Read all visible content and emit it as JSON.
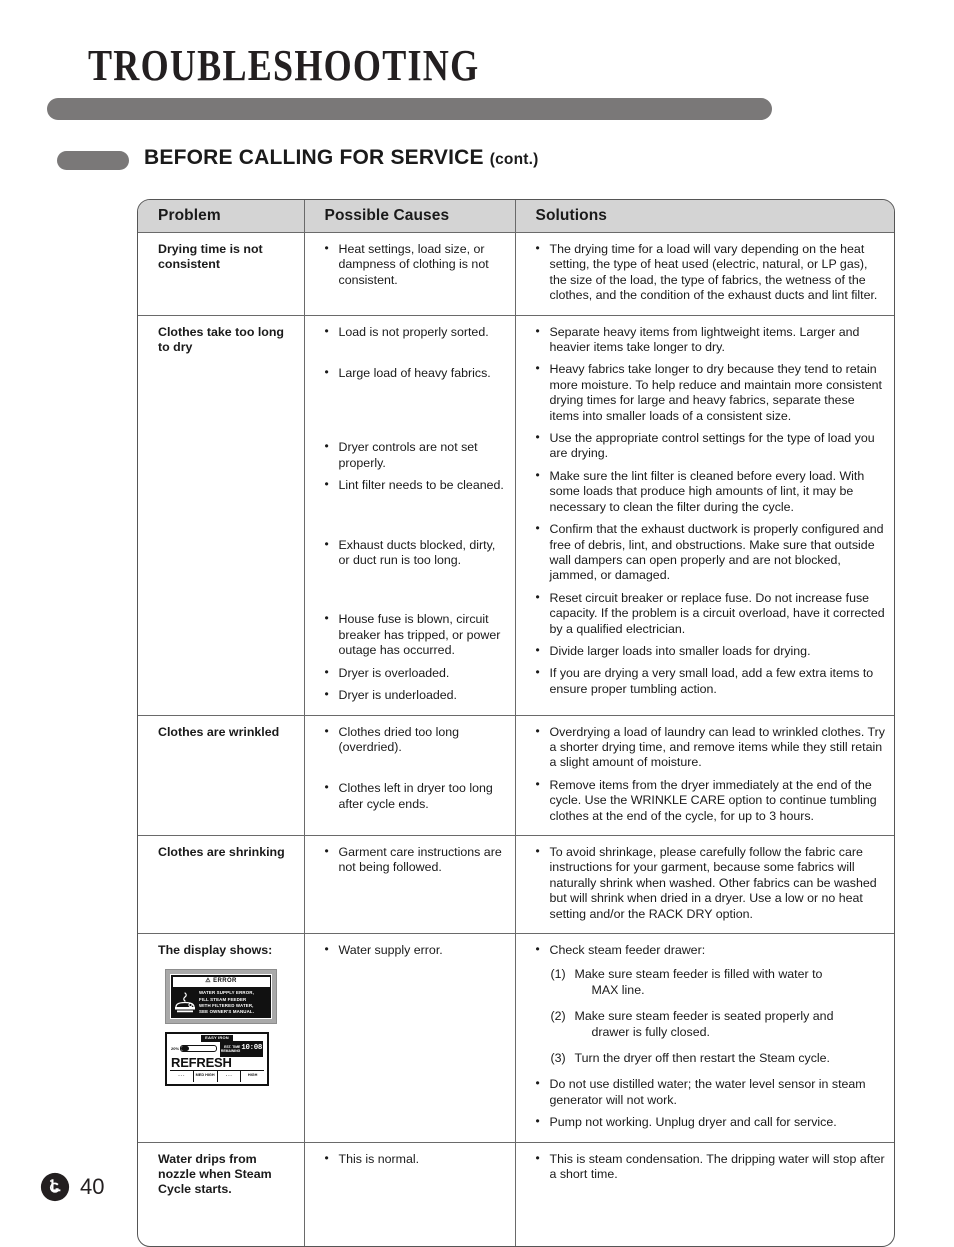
{
  "header": {
    "title": "TROUBLESHOOTING",
    "section_title": "BEFORE CALLING FOR SERVICE",
    "section_suffix": "(cont.)",
    "bar_color": "#7a7878"
  },
  "table": {
    "columns": [
      "Problem",
      "Possible Causes",
      "Solutions"
    ],
    "rows": [
      {
        "problem": "Drying time is not consistent",
        "causes": [
          "Heat settings, load size, or dampness of clothing is not consistent."
        ],
        "solutions": [
          "The drying time for a load will vary depending on the heat setting, the type of heat used (electric, natural, or LP gas), the size of the load, the type of fabrics, the wetness of the clothes, and the condition of the exhaust ducts and lint filter."
        ]
      },
      {
        "problem": "Clothes take too long to dry",
        "causes": [
          "Load is not properly sorted.",
          "Large load of heavy fabrics.",
          "Dryer controls are not set properly.",
          "Lint filter needs to be cleaned.",
          "Exhaust ducts blocked, dirty, or duct run is too long.",
          "House fuse is blown, circuit breaker has tripped, or power outage has occurred.",
          "Dryer is overloaded.",
          "Dryer is underloaded."
        ],
        "solutions": [
          "Separate heavy items from lightweight items. Larger and heavier items take longer to dry.",
          "Heavy fabrics take longer to dry because they tend to retain more moisture. To help reduce and maintain more consistent drying times for large and heavy fabrics, separate these items into smaller loads of a consistent size.",
          "Use the appropriate control settings for the type of load you are drying.",
          "Make sure the lint filter is cleaned before every load. With some loads that produce high amounts of lint, it may be necessary to clean the filter during the cycle.",
          "Confirm that the exhaust ductwork is properly configured and free of debris, lint, and obstructions. Make sure that outside wall dampers can open properly and are not blocked, jammed, or damaged.",
          "Reset circuit breaker or replace fuse. Do not increase fuse capacity. If the problem is a circuit overload, have it corrected by a qualified electrician.",
          "Divide larger loads into smaller loads for drying.",
          "If you are drying a very small load, add a few extra items to ensure proper tumbling action."
        ]
      },
      {
        "problem": "Clothes are wrinkled",
        "causes": [
          "Clothes dried too long (overdried).",
          "Clothes left in dryer too long after cycle ends."
        ],
        "solutions": [
          "Overdrying a load of laundry can lead to wrinkled clothes. Try a shorter drying time, and remove items while they still retain a slight amount of moisture.",
          "Remove items from the dryer immediately at the end of the cycle. Use the WRINKLE CARE option to continue tumbling clothes at the end of the cycle, for up to 3 hours."
        ]
      },
      {
        "problem": "Clothes are shrinking",
        "causes": [
          "Garment care instructions are not being followed."
        ],
        "solutions": [
          "To avoid shrinkage, please carefully follow the fabric care instructions for your garment, because some fabrics will naturally shrink when washed. Other fabrics can be washed but will shrink when dried in a dryer. Use a low or no heat setting and/or the RACK DRY option."
        ]
      },
      {
        "problem": "The display shows:",
        "causes": [
          "Water supply error."
        ],
        "solutions_lead": "Check steam feeder drawer:",
        "solutions_numbered": [
          {
            "num": "(1)",
            "line1": "Make sure steam feeder is filled with water to",
            "line2": "MAX line."
          },
          {
            "num": "(2)",
            "line1": "Make sure steam feeder is seated properly and",
            "line2": "drawer is fully closed."
          },
          {
            "num": "(3)",
            "line1": "Turn the dryer off then restart the Steam cycle.",
            "line2": ""
          }
        ],
        "solutions_tail": [
          "Do not use distilled water; the water level sensor in steam generator will not work.",
          "Pump not working. Unplug dryer and call for service."
        ]
      },
      {
        "problem": "Water drips from nozzle when Steam Cycle starts.",
        "causes": [
          "This is normal."
        ],
        "solutions": [
          "This is steam condensation. The dripping water will stop after a short time."
        ]
      }
    ]
  },
  "display_error": {
    "title": "ERROR",
    "lines": [
      "WATER SUPPLY ERROR,",
      "FILL STEAM FEEDER",
      "WITH FILTERED WATER,",
      "SEE OWNER'S MANUAL."
    ]
  },
  "display_refresh": {
    "chip": "EASY IRON",
    "percent": "20%",
    "time_label_1": "EST. TIME",
    "time_label_2": "REMAINING",
    "time": "10:08",
    "cycle_name": "REFRESH",
    "bottom_cells": [
      "- - -",
      "MED HIGH",
      "- - -",
      "HIGH"
    ]
  },
  "footer": {
    "page_number": "40",
    "logo": "lg-logo"
  }
}
